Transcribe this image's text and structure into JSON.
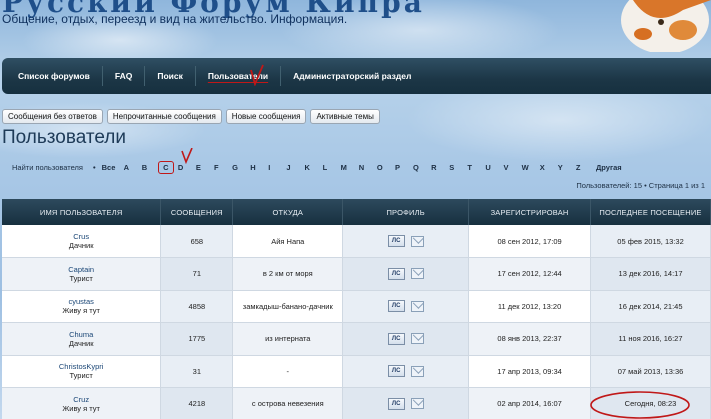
{
  "header": {
    "site_title": "Русский Форум Кипра",
    "site_subtitle": "Общение, отдых, переезд и вид на жительство. Информация."
  },
  "nav": {
    "items": [
      "Список форумов",
      "FAQ",
      "Поиск",
      "Пользователи",
      "Администраторский раздел"
    ]
  },
  "quick_links": [
    "Сообщения без ответов",
    "Непрочитанные сообщения",
    "Новые сообщения",
    "Активные темы"
  ],
  "page_title": "Пользователи",
  "alphabet": {
    "find_label": "Найти пользователя",
    "bullet": "•",
    "all_label": "Все",
    "letters": [
      "A",
      "B",
      "C",
      "D",
      "E",
      "F",
      "G",
      "H",
      "I",
      "J",
      "K",
      "L",
      "M",
      "N",
      "O",
      "P",
      "Q",
      "R",
      "S",
      "T",
      "U",
      "V",
      "W",
      "X",
      "Y",
      "Z"
    ],
    "other_label": "Другая"
  },
  "pagination": {
    "text": "Пользователей: 15 • Страница 1 из 1"
  },
  "table": {
    "headers": [
      "ИМЯ ПОЛЬЗОВАТЕЛЯ",
      "СООБЩЕНИЯ",
      "ОТКУДА",
      "ПРОФИЛЬ",
      "ЗАРЕГИСТРИРОВАН",
      "ПОСЛЕДНЕЕ ПОСЕЩЕНИЕ"
    ],
    "pm_label": "ЛС",
    "rows": [
      {
        "name": "Crus",
        "rank": "Дачник",
        "posts": "658",
        "from": "Айя Напа",
        "registered": "08 сен 2012, 17:09",
        "last": "05 фев 2015, 13:32"
      },
      {
        "name": "Captain",
        "rank": "Турист",
        "posts": "71",
        "from": "в 2 км от моря",
        "registered": "17 сен 2012, 12:44",
        "last": "13 дек 2016, 14:17"
      },
      {
        "name": "cyustas",
        "rank": "Живу я тут",
        "posts": "4858",
        "from": "замкадыш-банано-дачник",
        "registered": "11 дек 2012, 13:20",
        "last": "16 дек 2014, 21:45"
      },
      {
        "name": "Chuma",
        "rank": "Дачник",
        "posts": "1775",
        "from": "из интерната",
        "registered": "08 янв 2013, 22:37",
        "last": "11 ноя 2016, 16:27"
      },
      {
        "name": "ChristosKypri",
        "rank": "Турист",
        "posts": "31",
        "from": "-",
        "registered": "17 апр 2013, 09:34",
        "last": "07 май 2013, 13:36"
      },
      {
        "name": "Cruz",
        "rank": "Живу я тут",
        "posts": "4218",
        "from": "с острова невезения",
        "registered": "02 апр 2014, 16:07",
        "last": "Сегодня, 08:23"
      }
    ]
  },
  "colors": {
    "nav_bg": "#1c3646",
    "annotation_red": "#c01818",
    "link": "#1a4676"
  }
}
